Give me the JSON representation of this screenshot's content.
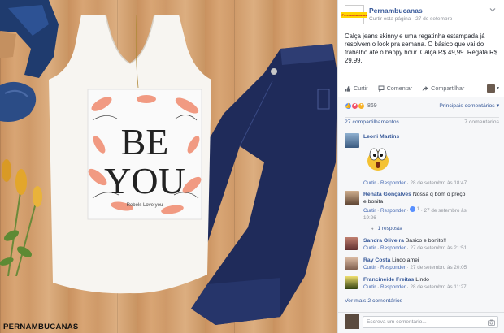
{
  "photo": {
    "watermark": "PERNAMBUCANAS",
    "shirt_print": {
      "line1": "BE",
      "line2": "YOU",
      "tagline": "Rebels   Love you"
    }
  },
  "post": {
    "page_name": "Pernambucanas",
    "page_logo_text": "Pernambucanas",
    "like_page_link": "Curtir esta página",
    "separator": "·",
    "date": "27 de setembro",
    "text": "Calça jeans skinny e uma regatinha estampada já resolvem o look pra semana. O básico que vai do trabalho até o happy hour. Calça R$ 49,99. Regata R$ 29,99.",
    "actions": {
      "like": "Curtir",
      "comment": "Comentar",
      "share": "Compartilhar"
    },
    "reaction_count": "869",
    "top_comments": "Principais comentários ▾",
    "shares": "27 compartilhamentos",
    "comments_count": "7 comentários",
    "see_more_comments": "Ver mais 2 comentários",
    "write_placeholder": "Escreva um comentário..."
  },
  "comments": [
    {
      "name": "Leoni Martins",
      "text": "",
      "like": "Curtir",
      "reply": "Responder",
      "time": "28 de setembro às 18:47"
    },
    {
      "name": "Renata Gonçalves",
      "text": "Nossa q bom o preço",
      "text2": "e bonita",
      "like": "Curtir",
      "reply": "Responder",
      "likes": "1",
      "time": "27 de setembro às",
      "time2": "19:26",
      "replies": "1 resposta"
    },
    {
      "name": "Sandra Oliveira",
      "text": "Básico e bonito!!",
      "like": "Curtir",
      "reply": "Responder",
      "time": "27 de setembro às 21:51"
    },
    {
      "name": "Ray Costa",
      "text": "Lindo amei",
      "like": "Curtir",
      "reply": "Responder",
      "time": "27 de setembro às 20:05"
    },
    {
      "name": "Francineide Freitas",
      "text": "Lindo",
      "like": "Curtir",
      "reply": "Responder",
      "time": "28 de setembro às 11:27"
    }
  ],
  "colors": {
    "link": "#365899",
    "meta": "#90949c",
    "denim": "#1f2b5a",
    "print_coral": "#f08a6e"
  }
}
